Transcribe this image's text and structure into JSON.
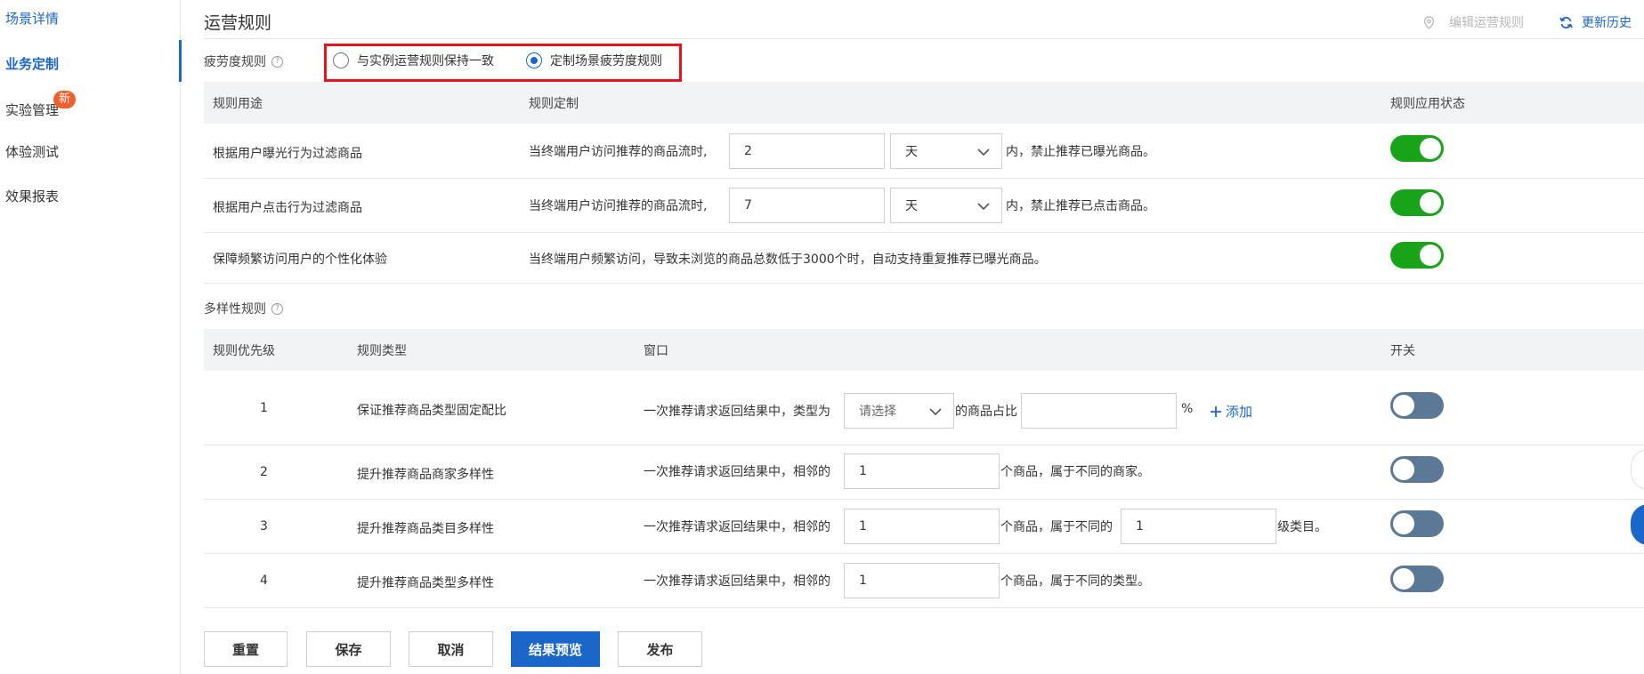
{
  "sidebar": {
    "items": [
      {
        "label": "场景详情"
      },
      {
        "label": "业务定制"
      },
      {
        "label": "实验管理"
      },
      {
        "label": "体验测试"
      },
      {
        "label": "效果报表"
      }
    ],
    "new_badge": "新"
  },
  "header": {
    "title": "运营规则",
    "edit_label": "编辑运营规则",
    "history_label": "更新历史"
  },
  "fatigue": {
    "label": "疲劳度规则",
    "option_consistent": "与实例运营规则保持一致",
    "option_custom": "定制场景疲劳度规则",
    "selected": "定制场景疲劳度规则",
    "columns": {
      "purpose": "规则用途",
      "custom": "规则定制",
      "status": "规则应用状态"
    },
    "rows": [
      {
        "purpose": "根据用户曝光行为过滤商品",
        "prefix": "当终端用户访问推荐的商品流时,",
        "value": "2",
        "unit": "天",
        "suffix": "内，禁止推荐已曝光商品。",
        "enabled": true
      },
      {
        "purpose": "根据用户点击行为过滤商品",
        "prefix": "当终端用户访问推荐的商品流时,",
        "value": "7",
        "unit": "天",
        "suffix": "内，禁止推荐已点击商品。",
        "enabled": true
      },
      {
        "purpose": "保障频繁访问用户的个性化体验",
        "text": "当终端用户频繁访问，导致未浏览的商品总数低于3000个时，自动支持重复推荐已曝光商品。",
        "enabled": true
      }
    ]
  },
  "diversity": {
    "label": "多样性规则",
    "columns": {
      "priority": "规则优先级",
      "type": "规则类型",
      "window": "窗口",
      "switch": "开关"
    },
    "rows": [
      {
        "priority": "1",
        "type": "保证推荐商品类型固定配比",
        "prefix": "一次推荐请求返回结果中，类型为",
        "select_placeholder": "请选择",
        "mid": "的商品占比",
        "value": "",
        "percent": "%",
        "add_label": "添加",
        "enabled": false
      },
      {
        "priority": "2",
        "type": "提升推荐商品商家多样性",
        "prefix": "一次推荐请求返回结果中，相邻的",
        "value": "1",
        "suffix": "个商品，属于不同的商家。",
        "enabled": false
      },
      {
        "priority": "3",
        "type": "提升推荐商品类目多样性",
        "prefix": "一次推荐请求返回结果中，相邻的",
        "value": "1",
        "mid": "个商品，属于不同的",
        "value2": "1",
        "suffix": "级类目。",
        "enabled": false
      },
      {
        "priority": "4",
        "type": "提升推荐商品类型多样性",
        "prefix": "一次推荐请求返回结果中，相邻的",
        "value": "1",
        "suffix": "个商品，属于不同的类型。",
        "enabled": false
      }
    ]
  },
  "actions": {
    "reset": "重置",
    "save": "保存",
    "cancel": "取消",
    "preview": "结果预览",
    "publish": "发布"
  },
  "colors": {
    "accent": "#1a66c9",
    "toggle_on": "#19a319",
    "toggle_off": "#5b7897",
    "highlight": "#e8141b",
    "badge": "#f35f2b"
  }
}
